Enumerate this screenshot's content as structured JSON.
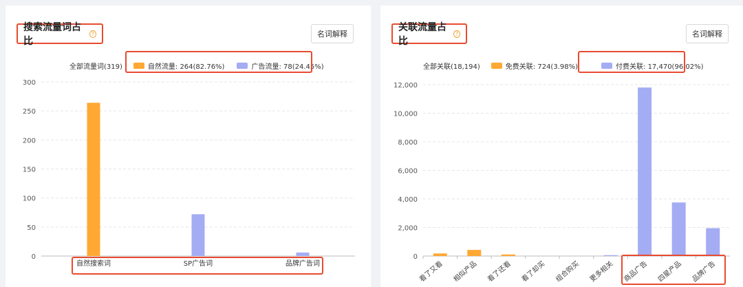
{
  "colors": {
    "orange": "#ffa833",
    "purple": "#a4acf4",
    "highlight": "#e84a2f",
    "grid": "#e6e6e6"
  },
  "left": {
    "title": "搜索流量词占比",
    "help_icon": "question-circle-icon",
    "explain_label": "名词解释",
    "legend": {
      "total": "全部流量词(319)",
      "items": [
        {
          "label": "自然流量: 264(82.76%)",
          "color": "#ffa833"
        },
        {
          "label": "广告流量: 78(24.45%)",
          "color": "#a4acf4"
        }
      ]
    },
    "chart_data": {
      "type": "bar",
      "categories": [
        "自然搜索词",
        "SP广告词",
        "品牌广告词"
      ],
      "series": [
        {
          "name": "自然流量",
          "color": "#ffa833",
          "values": [
            264,
            0,
            0
          ]
        },
        {
          "name": "广告流量",
          "color": "#a4acf4",
          "values": [
            0,
            72,
            6
          ]
        }
      ],
      "ylim": [
        0,
        300
      ],
      "yticks": [
        0,
        50,
        100,
        150,
        200,
        250,
        300
      ],
      "ytick_labels": [
        "0",
        "50",
        "100",
        "150",
        "200",
        "250",
        "300"
      ],
      "grid": true
    }
  },
  "right": {
    "title": "关联流量占比",
    "help_icon": "question-circle-icon",
    "explain_label": "名词解释",
    "legend": {
      "total": "全部关联(18,194)",
      "items": [
        {
          "label": "免费关联: 724(3.98%)",
          "color": "#ffa833"
        },
        {
          "label": "付费关联: 17,470(96.02%)",
          "color": "#a4acf4"
        }
      ]
    },
    "chart_data": {
      "type": "bar",
      "categories": [
        "看了又看",
        "相似产品",
        "看了还看",
        "看了却买",
        "组合购买",
        "更多相关",
        "商品广告",
        "四星产品",
        "品牌广告"
      ],
      "series": [
        {
          "name": "免费关联",
          "color": "#ffa833",
          "values": [
            180,
            430,
            110,
            0,
            0,
            0,
            0,
            0,
            0
          ]
        },
        {
          "name": "付费关联",
          "color": "#a4acf4",
          "values": [
            0,
            0,
            0,
            0,
            0,
            60,
            11800,
            3750,
            1950
          ]
        }
      ],
      "ylim": [
        0,
        12000
      ],
      "yticks": [
        0,
        2000,
        4000,
        6000,
        8000,
        10000,
        12000
      ],
      "ytick_labels": [
        "0",
        "2,000",
        "4,000",
        "6,000",
        "8,000",
        "10,000",
        "12,000"
      ],
      "grid": true
    }
  }
}
